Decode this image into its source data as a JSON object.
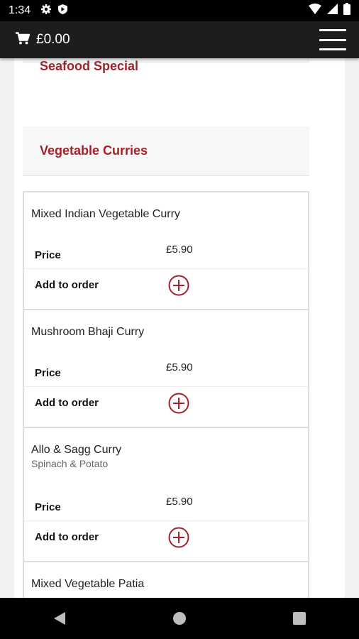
{
  "status_bar": {
    "time": "1:34",
    "left_icons": [
      "gear-icon",
      "shield-icon"
    ],
    "right_icons": [
      "wifi-icon",
      "signal-icon",
      "battery-icon"
    ]
  },
  "app_bar": {
    "cart_total": "£0.00",
    "icons": [
      "cart-icon",
      "hamburger-menu-icon"
    ]
  },
  "categories": [
    {
      "label": "Seafood Special"
    },
    {
      "label": "Vegetable Curries"
    }
  ],
  "items": [
    {
      "name": "Mixed Indian Vegetable Curry",
      "description": "",
      "price_label": "Price",
      "price": "£5.90",
      "add_label": "Add to order"
    },
    {
      "name": "Mushroom Bhaji Curry",
      "description": "",
      "price_label": "Price",
      "price": "£5.90",
      "add_label": "Add to order"
    },
    {
      "name": "Allo & Sagg Curry",
      "description": "Spinach & Potato",
      "price_label": "Price",
      "price": "£5.90",
      "add_label": "Add to order"
    },
    {
      "name": "Mixed Vegetable Patia",
      "description": "",
      "price_label": "",
      "price": "",
      "add_label": ""
    }
  ],
  "nav_bar": {
    "icons": [
      "back-icon",
      "home-icon",
      "recents-icon"
    ]
  },
  "colors": {
    "accent": "#a3212a",
    "app_bar": "#1d1d1d",
    "status_bar": "#000000"
  }
}
